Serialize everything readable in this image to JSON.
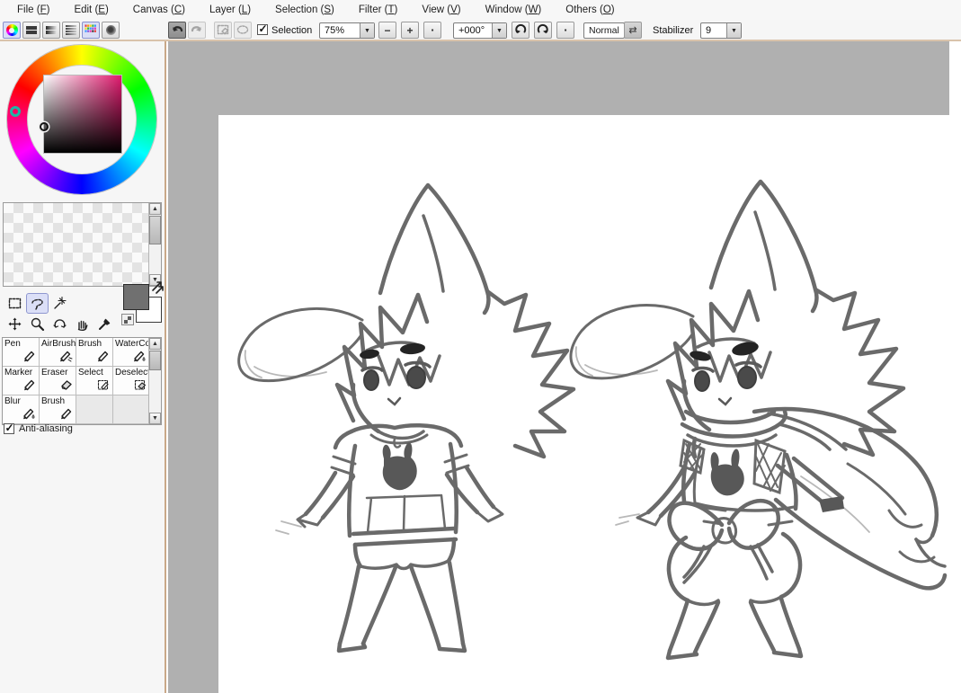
{
  "menu": {
    "items": [
      {
        "name": "File",
        "mnemonic": "F"
      },
      {
        "name": "Edit",
        "mnemonic": "E"
      },
      {
        "name": "Canvas",
        "mnemonic": "C"
      },
      {
        "name": "Layer",
        "mnemonic": "L"
      },
      {
        "name": "Selection",
        "mnemonic": "S"
      },
      {
        "name": "Filter",
        "mnemonic": "T"
      },
      {
        "name": "View",
        "mnemonic": "V"
      },
      {
        "name": "Window",
        "mnemonic": "W"
      },
      {
        "name": "Others",
        "mnemonic": "O"
      }
    ]
  },
  "toolbar": {
    "panel_buttons": [
      "color-wheel",
      "rgb-sliders",
      "hsv-sliders",
      "color-mixer",
      "swatches",
      "scratchpad"
    ],
    "selection_label": "Selection",
    "selection_checked": true,
    "zoom_value": "75%",
    "zoom_out_label": "−",
    "zoom_in_label": "+",
    "zoom_reset_label": "▪",
    "angle_value": "+000°",
    "blend_mode": "Normal",
    "stabilizer_label": "Stabilizer",
    "stabilizer_value": "9"
  },
  "color_panel": {
    "selected_color": "#e01a6e",
    "foreground_color": "#707070",
    "background_color": "#ffffff",
    "hue_marker_color": "#1fb6a6"
  },
  "tools_grid": {
    "selected": "lasso",
    "items": [
      {
        "name": "rect-select"
      },
      {
        "name": "lasso",
        "selected": true
      },
      {
        "name": "magic-wand"
      },
      null,
      null,
      {
        "name": "move"
      },
      {
        "name": "zoom"
      },
      {
        "name": "rotate"
      },
      {
        "name": "hand"
      },
      {
        "name": "eyedropper"
      }
    ]
  },
  "palette": {
    "cells": [
      {
        "label": "Pen",
        "icon": "pen"
      },
      {
        "label": "AirBrush",
        "icon": "airbrush"
      },
      {
        "label": "Brush",
        "icon": "brush"
      },
      {
        "label": "WaterCo",
        "icon": "watercolor"
      },
      {
        "label": "Marker",
        "icon": "pen"
      },
      {
        "label": "Eraser",
        "icon": "eraser"
      },
      {
        "label": "Select",
        "icon": "select"
      },
      {
        "label": "Deselect",
        "icon": "deselect"
      },
      {
        "label": "Blur",
        "icon": "watercolor"
      },
      {
        "label": "Brush",
        "icon": "brush"
      },
      null,
      null
    ]
  },
  "antialias": {
    "label": "Anti-aliasing",
    "checked": true
  },
  "colors": {
    "canvas_surround": "#b0b0b0",
    "panel_bg": "#f6f6f6",
    "separator_tan": "#d9c3ab",
    "sketch_stroke": "#6a6a6a"
  }
}
